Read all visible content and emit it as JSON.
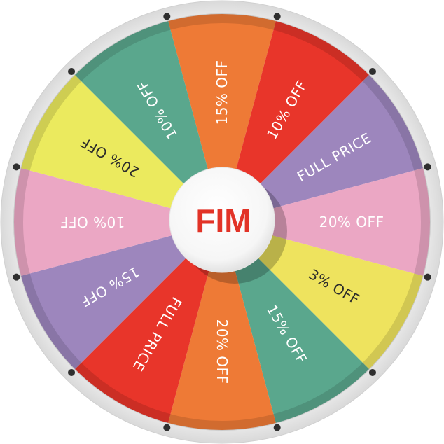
{
  "wheel": {
    "hub_label": "FIM",
    "hub_text_color": "#e23327",
    "segments": [
      {
        "label": "15% OFF",
        "color": "#ee7a36",
        "text_color": "#ffffff"
      },
      {
        "label": "10% OFF",
        "color": "#e8352a",
        "text_color": "#ffffff"
      },
      {
        "label": "FULL PRICE",
        "color": "#9d86bd",
        "text_color": "#ffffff"
      },
      {
        "label": "20% OFF",
        "color": "#eba7c4",
        "text_color": "#ffffff"
      },
      {
        "label": "3% OFF",
        "color": "#eee35e",
        "text_color": "#2b2b2b"
      },
      {
        "label": "15% OFF",
        "color": "#5aa78d",
        "text_color": "#ffffff"
      },
      {
        "label": "20% OFF",
        "color": "#ee7a36",
        "text_color": "#ffffff"
      },
      {
        "label": "FULL PRICE",
        "color": "#e8352a",
        "text_color": "#ffffff"
      },
      {
        "label": "15% OFF",
        "color": "#9d86bd",
        "text_color": "#ffffff"
      },
      {
        "label": "10% OFF",
        "color": "#eba7c4",
        "text_color": "#ffffff"
      },
      {
        "label": "20% OFF",
        "color": "#ebea5e",
        "text_color": "#2b2b2b"
      },
      {
        "label": "10% OFF",
        "color": "#5aa78d",
        "text_color": "#ffffff"
      }
    ]
  }
}
